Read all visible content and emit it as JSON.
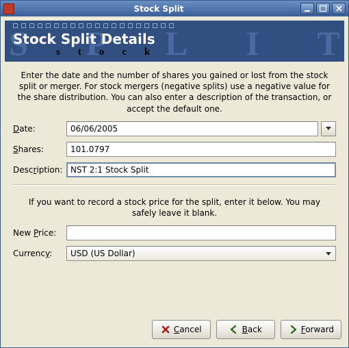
{
  "window": {
    "title": "Stock Split"
  },
  "banner": {
    "headline": "Stock Split Details",
    "watermark": "SPLIT",
    "subword": "stock"
  },
  "instructions": {
    "top": "Enter the date and the number of shares you gained or lost from the stock split or merger. For stock mergers (negative splits) use a negative value for the share distribution. You can also enter a description of the transaction, or accept the default one.",
    "bottom": "If you want to record a stock price for the split, enter it below. You may safely leave it blank."
  },
  "fields": {
    "date": {
      "label": "Date:",
      "value": "06/06/2005"
    },
    "shares": {
      "label": "Shares:",
      "value": "101.0797"
    },
    "description": {
      "label": "Description:",
      "value": "NST 2:1 Stock Split"
    },
    "new_price": {
      "label": "New Price:",
      "value": ""
    },
    "currency": {
      "label": "Currency:",
      "value": "USD (US Dollar)"
    }
  },
  "buttons": {
    "cancel": "Cancel",
    "back": "Back",
    "forward": "Forward"
  }
}
